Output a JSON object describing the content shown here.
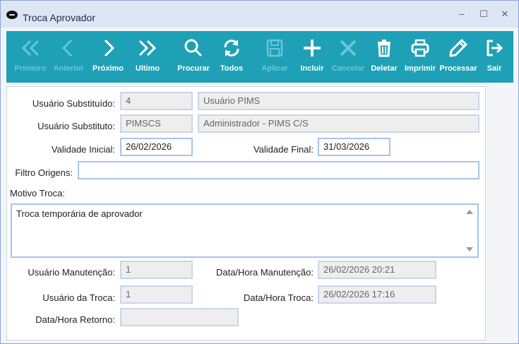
{
  "window": {
    "title": "Troca Aprovador",
    "minimize": "‒",
    "maximize": "☐",
    "close": "✕"
  },
  "toolbar": {
    "primeiro": "Primeiro",
    "anterior": "Anterior",
    "proximo": "Próximo",
    "ultimo": "Ultimo",
    "procurar": "Procurar",
    "todos": "Todos",
    "aplicar": "Aplicar",
    "incluir": "Incluir",
    "cancelar": "Cancelar",
    "deletar": "Deletar",
    "imprimir": "Imprimir",
    "processar": "Processar",
    "sair": "Sair"
  },
  "form": {
    "usuario_substituido_label": "Usuário Substituído:",
    "usuario_substituido_code": "4",
    "usuario_substituido_name": "Usuário PIMS",
    "usuario_substituto_label": "Usuário Substituto:",
    "usuario_substituto_code": "PIMSCS",
    "usuario_substituto_name": "Administrador - PIMS C/S",
    "validade_inicial_label": "Validade Inicial:",
    "validade_inicial": "26/02/2026",
    "validade_final_label": "Validade Final:",
    "validade_final": "31/03/2026",
    "filtro_origens_label": "Filtro Origens:",
    "filtro_origens": "",
    "motivo_troca_label": "Motivo Troca:",
    "motivo_troca": "Troca temporária de aprovador",
    "usuario_manutencao_label": "Usuário Manutenção:",
    "usuario_manutencao": "1",
    "data_hora_manutencao_label": "Data/Hora Manutenção:",
    "data_hora_manutencao": "26/02/2026 20:21",
    "usuario_troca_label": "Usuário da Troca:",
    "usuario_troca": "1",
    "data_hora_troca_label": "Data/Hora Troca:",
    "data_hora_troca": "26/02/2026 17:16",
    "data_hora_retorno_label": "Data/Hora Retorno:",
    "data_hora_retorno": ""
  },
  "colors": {
    "toolbar_bg": "#1ea0b6",
    "disabled_text": "#69c6d6",
    "field_border": "#a9c3ea"
  }
}
